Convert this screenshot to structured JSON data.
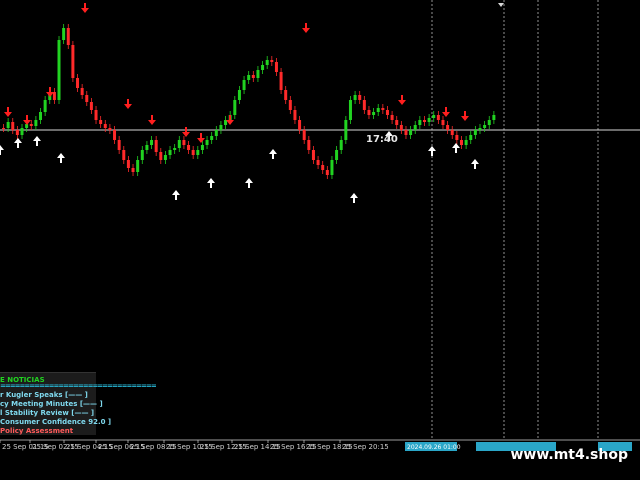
{
  "chart": {
    "current_time_label": "17:40",
    "x_ticks": [
      "25 Sep 01:15",
      "25 Sep 02:15",
      "25 Sep 04:15",
      "25 Sep 06:15",
      "25 Sep 08:15",
      "25 Sep 10:15",
      "25 Sep 12:15",
      "25 Sep 14:15",
      "25 Sep 16:15",
      "25 Sep 18:15",
      "25 Sep 20:15"
    ],
    "highlight_time": "2024.09.26 01:00",
    "colors": {
      "bull": "#21d321",
      "bear": "#ff2a2a",
      "up_arrow": "#ffffff",
      "down_arrow": "#ff1f1f",
      "price_line": "#d9d9d9",
      "highlight": "#2aa6c8"
    }
  },
  "panel": {
    "title": "E NOTICIAS",
    "separator": "================================",
    "lines": [
      "r Kugler Speaks [—— ]",
      "cy Meeting Minutes [—— ]",
      "l Stability Review [—— ]",
      "Consumer Confidence  92.0 ]",
      "Policy Assessment"
    ]
  },
  "watermark": "www.mt4.shop"
}
